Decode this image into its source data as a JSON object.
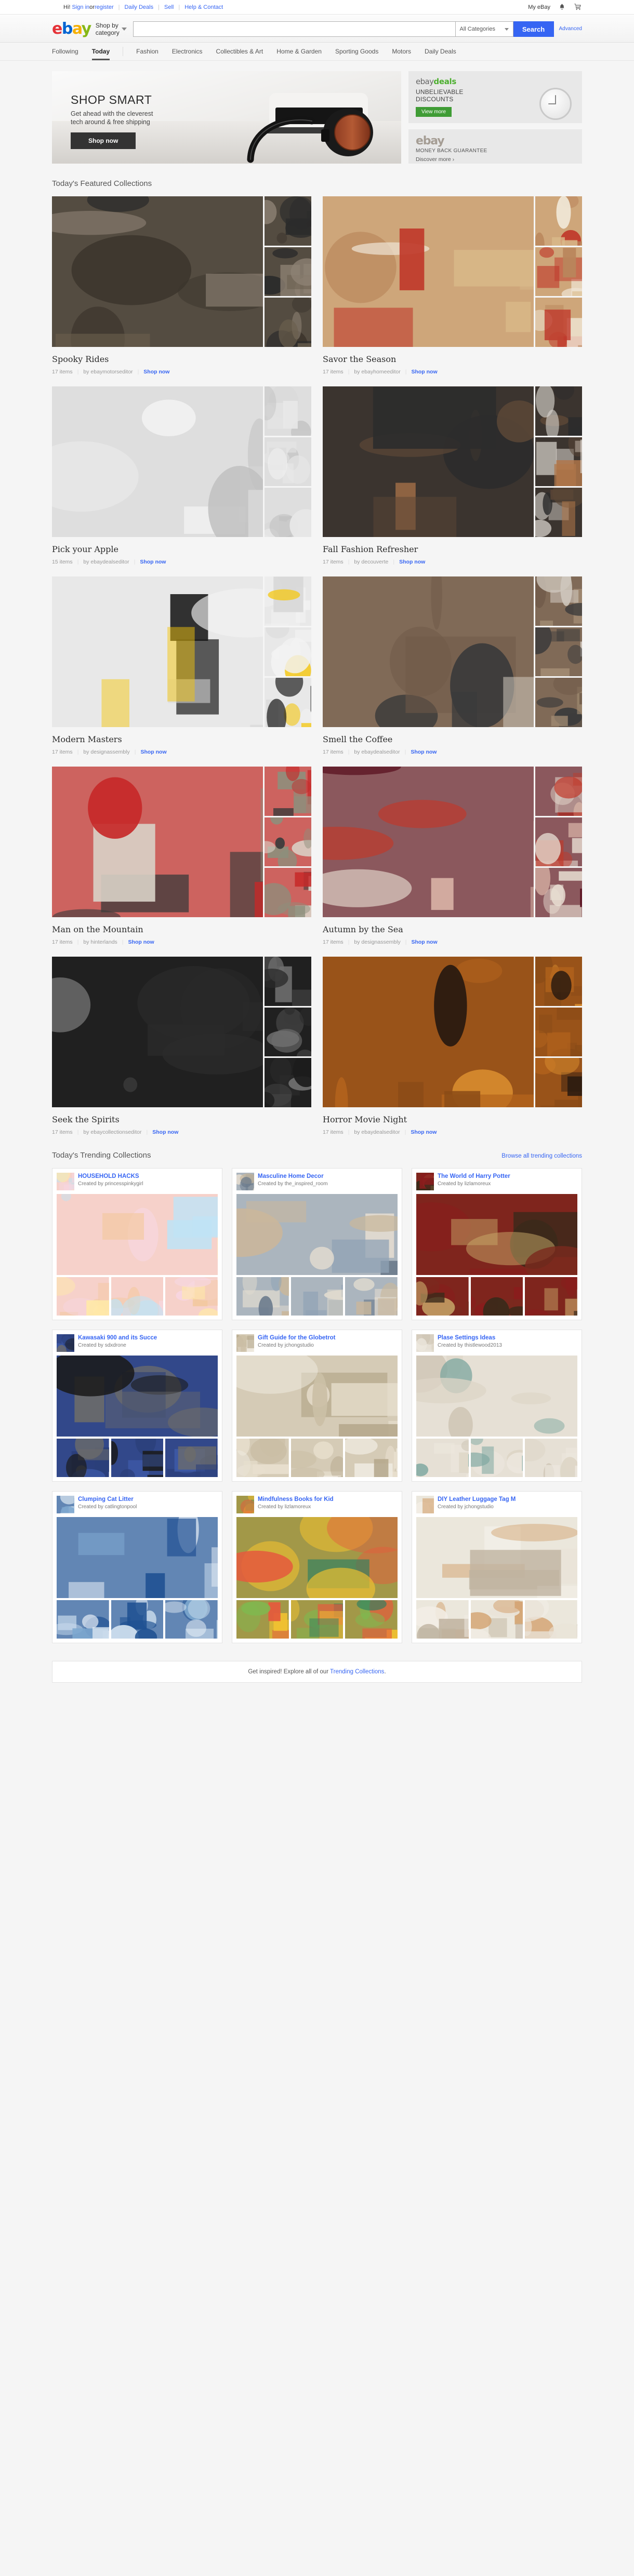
{
  "utility_bar": {
    "greeting": "Hi!",
    "signin": "Sign in",
    "or": " or ",
    "register": "register",
    "links": [
      "Daily Deals",
      "Sell",
      "Help & Contact"
    ],
    "my_ebay": "My eBay",
    "bell_icon": "notifications-bell-icon",
    "cart_icon": "shopping-cart-icon"
  },
  "header": {
    "logo": {
      "e": "e",
      "b": "b",
      "a": "a",
      "y": "y"
    },
    "shop_by_category": "Shop by\ncategory",
    "search_placeholder": "",
    "search_value": "",
    "category_selected": "All Categories",
    "search_button": "Search",
    "advanced": "Advanced"
  },
  "nav": {
    "items": [
      {
        "label": "Following",
        "active": false
      },
      {
        "label": "Today",
        "active": true
      },
      {
        "label": "Fashion",
        "active": false
      },
      {
        "label": "Electronics",
        "active": false
      },
      {
        "label": "Collectibles & Art",
        "active": false
      },
      {
        "label": "Home & Garden",
        "active": false
      },
      {
        "label": "Sporting Goods",
        "active": false
      },
      {
        "label": "Motors",
        "active": false
      },
      {
        "label": "Daily Deals",
        "active": false
      }
    ]
  },
  "hero": {
    "title": "SHOP SMART",
    "sub_line1": "Get ahead with the cleverest",
    "sub_line2": "tech around & free shipping",
    "button": "Shop now"
  },
  "promos": {
    "deals": {
      "logo_ebay": "ebay",
      "logo_deals": "deals",
      "head_line1": "UNBELIEVABLE",
      "head_line2": "DISCOUNTS",
      "button": "View more",
      "accent": "#3f9c35"
    },
    "mbg": {
      "logo": "ebay",
      "subtitle": "MONEY BACK GUARANTEE",
      "link": "Discover more ›"
    }
  },
  "featured": {
    "title": "Today's Featured Collections",
    "items_label": "items",
    "by_label": "by",
    "shop_now": "Shop now",
    "collections": [
      {
        "title": "Spooky Rides",
        "items": "17 items",
        "author": "by ebaymotorseditor",
        "shop": "Shop now",
        "theme": "spooky"
      },
      {
        "title": "Savor the Season",
        "items": "17 items",
        "author": "by ebayhomeeditor",
        "shop": "Shop now",
        "theme": "pie"
      },
      {
        "title": "Pick your Apple",
        "items": "15 items",
        "author": "by ebaydealseditor",
        "shop": "Shop now",
        "theme": "apple"
      },
      {
        "title": "Fall Fashion Refresher",
        "items": "17 items",
        "author": "by decouverte",
        "shop": "Shop now",
        "theme": "fashion"
      },
      {
        "title": "Modern Masters",
        "items": "17 items",
        "author": "by designassembly",
        "shop": "Shop now",
        "theme": "modern"
      },
      {
        "title": "Smell the Coffee",
        "items": "17 items",
        "author": "by ebaydealseditor",
        "shop": "Shop now",
        "theme": "coffee"
      },
      {
        "title": "Man on the Mountain",
        "items": "17 items",
        "author": "by hinterlands",
        "shop": "Shop now",
        "theme": "jacket"
      },
      {
        "title": "Autumn by the Sea",
        "items": "17 items",
        "author": "by designassembly",
        "shop": "Shop now",
        "theme": "painters"
      },
      {
        "title": "Seek the Spirits",
        "items": "17 items",
        "author": "by ebaycollectionseditor",
        "shop": "Shop now",
        "theme": "spirits"
      },
      {
        "title": "Horror Movie Night",
        "items": "17 items",
        "author": "by ebaydealseditor",
        "shop": "Shop now",
        "theme": "horror"
      }
    ]
  },
  "trending": {
    "title": "Today's Trending Collections",
    "browse_all": "Browse all trending collections",
    "created_by_prefix": "Created by ",
    "collections": [
      {
        "name": "HOUSEHOLD HACKS",
        "creator": "Created by princesspinkygirl",
        "theme": "hacks"
      },
      {
        "name": "Masculine Home Decor",
        "creator": "Created by the_inspired_room",
        "theme": "decor"
      },
      {
        "name": "The World of Harry Potter",
        "creator": "Created by lizlamoreux",
        "theme": "potter"
      },
      {
        "name": "Kawasaki 900 and its Succe",
        "creator": "Created by sdxdrone",
        "theme": "moto"
      },
      {
        "name": "Gift Guide for the Globetrot",
        "creator": "Created by jchongstudio",
        "theme": "travel"
      },
      {
        "name": "Plase Settings Ideas",
        "creator": "Created by thistlewood2013",
        "theme": "plates"
      },
      {
        "name": "Clumping Cat Litter",
        "creator": "Created by catlingtonpool",
        "theme": "litter"
      },
      {
        "name": "Mindfulness Books for Kid",
        "creator": "Created by lizlamoreux",
        "theme": "books"
      },
      {
        "name": "DIY Leather Luggage Tag M",
        "creator": "Created by jchongstudio",
        "theme": "leather"
      }
    ]
  },
  "footer_cta": {
    "text_before": "Get inspired! Explore all of our ",
    "link": "Trending Collections",
    "text_after": "."
  }
}
